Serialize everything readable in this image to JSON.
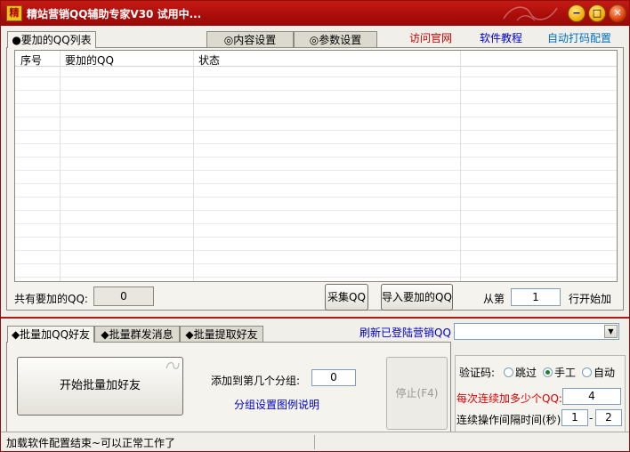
{
  "window": {
    "title": "精站营销QQ辅助专家V30 试用中...",
    "app_icon_char": "精",
    "minimize": "−",
    "restore": "□",
    "close": "✕"
  },
  "tabs_top": [
    {
      "label": "●要加的QQ列表",
      "active": true
    },
    {
      "label": "◎内容设置",
      "active": false
    },
    {
      "label": "◎参数设置",
      "active": false
    }
  ],
  "links": {
    "official_site": "访问官网",
    "tutorial": "软件教程",
    "auto_captcha": "自动打码配置"
  },
  "table": {
    "columns": [
      "序号",
      "要加的QQ",
      "状态"
    ],
    "rows": []
  },
  "summary": {
    "total_label": "共有要加的QQ:",
    "total_value": "0",
    "collect_button": "采集QQ",
    "import_button": "导入要加的QQ",
    "from_label": "从第",
    "from_value": "1",
    "row_start_label": "行开始加"
  },
  "tabs_bottom": [
    {
      "label": "◆批量加QQ好友",
      "active": true
    },
    {
      "label": "◆批量群发消息",
      "active": false
    },
    {
      "label": "◆批量提取好友",
      "active": false
    }
  ],
  "refresh_link": "刷新已登陆营销QQ",
  "account_select": {
    "value": ""
  },
  "batch": {
    "start_button": "开始批量加好友",
    "group_label": "添加到第几个分组:",
    "group_value": "0",
    "group_help_link": "分组设置图例说明",
    "stop_button": "停止(F4)"
  },
  "settings": {
    "captcha_label": "验证码:",
    "captcha_options": [
      {
        "label": "跳过",
        "checked": false
      },
      {
        "label": "手工",
        "checked": true
      },
      {
        "label": "自动",
        "checked": false
      }
    ],
    "per_run_label": "每次连续加多少个QQ:",
    "per_run_value": "4",
    "interval_label": "连续操作间隔时间(秒)",
    "interval_min": "1",
    "interval_dash": "-",
    "interval_max": "2"
  },
  "status": {
    "message": "加载软件配置结束~可以正常工作了"
  },
  "colors": {
    "title_bar": "#b0110d",
    "link_red": "#cc0000",
    "link_blue": "#0000cc",
    "link_teal": "#0070c0",
    "highlight_red": "#e00000"
  }
}
